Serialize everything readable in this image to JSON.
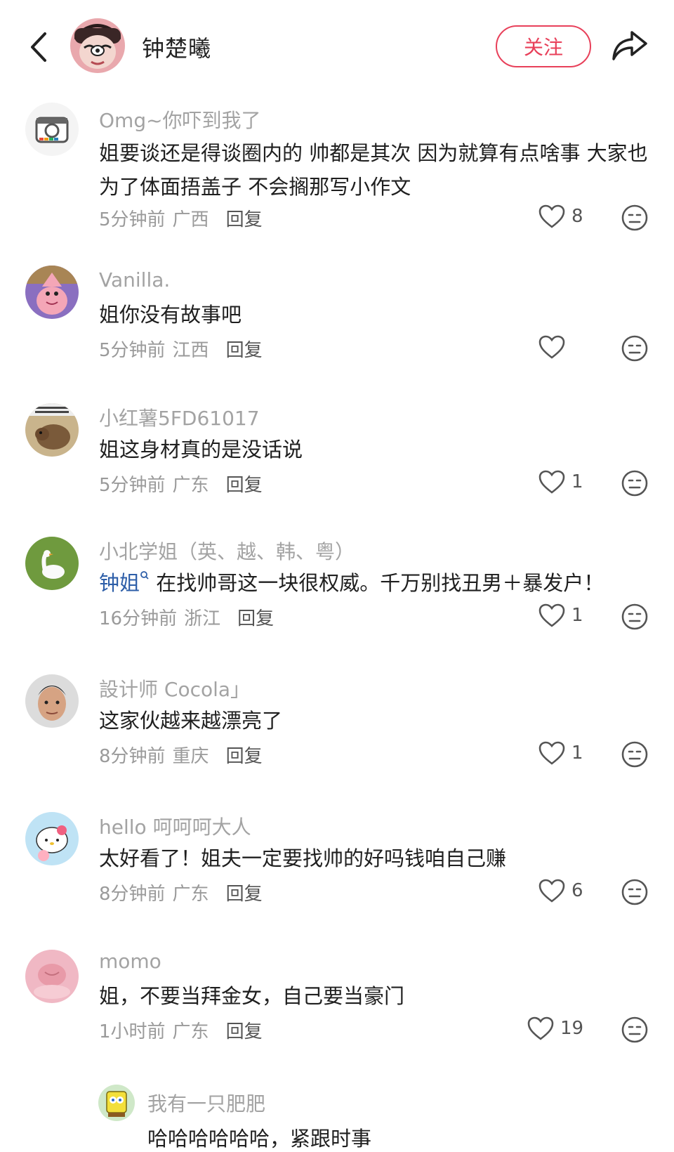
{
  "header": {
    "author_name": "钟楚曦",
    "follow_label": "关注"
  },
  "comments": [
    {
      "user": "Omg~你吓到我了",
      "text": "姐要谈还是得谈圈内的 帅都是其次 因为就算有点啥事 大家也为了体面捂盖子 不会搁那写小作文",
      "time": "5分钟前",
      "region": "广西",
      "reply": "回复",
      "likes": "8"
    },
    {
      "user": "Vanilla.",
      "text": "姐你没有故事吧",
      "time": "5分钟前",
      "region": "江西",
      "reply": "回复",
      "likes": ""
    },
    {
      "user": "小红薯5FD61017",
      "text": "姐这身材真的是没话说",
      "time": "5分钟前",
      "region": "广东",
      "reply": "回复",
      "likes": "1"
    },
    {
      "user": "小北学姐（英、越、韩、粤）",
      "mention": "钟姐",
      "text": " 在找帅哥这一块很权威。千万别找丑男＋暴发户！",
      "time": "16分钟前",
      "region": "浙江",
      "reply": "回复",
      "likes": "1"
    },
    {
      "user": "設计师 Cocola」",
      "text": "这家伙越来越漂亮了",
      "time": "8分钟前",
      "region": "重庆",
      "reply": "回复",
      "likes": "1"
    },
    {
      "user": "hello 呵呵呵大人",
      "text": "太好看了！姐夫一定要找帅的好吗钱咱自己赚",
      "time": "8分钟前",
      "region": "广东",
      "reply": "回复",
      "likes": "6"
    },
    {
      "user": "momo",
      "text": "姐，不要当拜金女，自己要当豪门",
      "time": "1小时前",
      "region": "广东",
      "reply": "回复",
      "likes": "19"
    }
  ],
  "sub_reply": {
    "user": "我有一只肥肥",
    "text": "哈哈哈哈哈哈，紧跟时事"
  },
  "colors": {
    "accent": "#e8405a",
    "mention": "#2d5ea8",
    "secondary_text": "#a3a3a3"
  }
}
